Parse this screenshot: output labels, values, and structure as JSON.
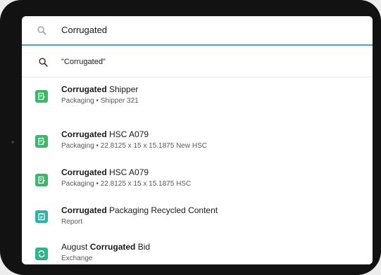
{
  "search": {
    "value": "Corrugated"
  },
  "query_suggestion": {
    "label": "\"Corrugated\""
  },
  "results": [
    {
      "highlight": "Corrugated",
      "rest": " Shipper",
      "prefix": "",
      "subtitle": "Packaging • Shipper 321",
      "icon": "document-edit-icon",
      "color": "#3db66b"
    },
    {
      "highlight": "Corrugated",
      "rest": " HSC A079",
      "prefix": "",
      "subtitle": "Packaging • 22.8125 x 15 x 15.1875 New HSC",
      "icon": "document-edit-icon",
      "color": "#3db66b"
    },
    {
      "highlight": "Corrugated",
      "rest": " HSC A079",
      "prefix": "",
      "subtitle": "Packaging • 22.8125 x 15 x 15.1875 HSC",
      "icon": "document-edit-icon",
      "color": "#3db66b"
    },
    {
      "highlight": "Corrugated",
      "rest": " Packaging Recycled Content",
      "prefix": "",
      "subtitle": "Report",
      "icon": "report-icon",
      "color": "#2bb3a6"
    },
    {
      "highlight": "Corrugated",
      "rest": " Bid",
      "prefix": "August ",
      "subtitle": "Exchange",
      "icon": "exchange-icon",
      "color": "#2fb48a"
    }
  ]
}
